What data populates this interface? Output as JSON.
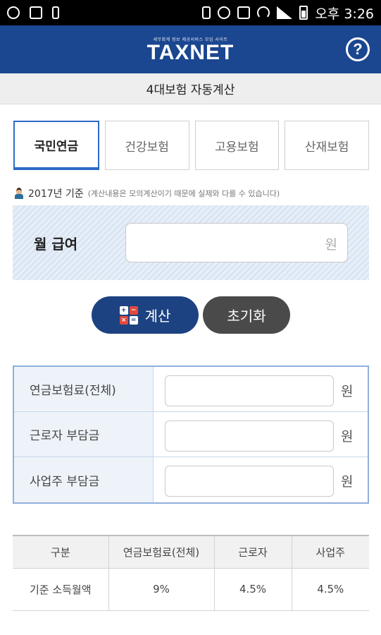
{
  "status_bar": {
    "time": "오후 3:26",
    "icons": [
      "sync-icon",
      "alert-icon",
      "usb-icon",
      "vibrate-icon",
      "alarm-icon",
      "card-icon",
      "wifi-icon",
      "signal-icon",
      "battery-icon"
    ]
  },
  "header": {
    "logo_subtitle": "세무회계 정보 제공서비스 모임 사이트",
    "logo": "TAXNET",
    "help_label": "?"
  },
  "page_title": "4대보험 자동계산",
  "tabs": [
    {
      "label": "국민연금",
      "active": true
    },
    {
      "label": "건강보험",
      "active": false
    },
    {
      "label": "고용보험",
      "active": false
    },
    {
      "label": "산재보험",
      "active": false
    }
  ],
  "note": {
    "year_text": "2017년 기준",
    "detail": "(계산내용은 모의계산이기 때문에 실제와 다를 수 있습니다)"
  },
  "salary": {
    "label": "월 급여",
    "value": "",
    "unit": "원"
  },
  "buttons": {
    "calculate": "계산",
    "reset": "초기화"
  },
  "results": [
    {
      "label": "연금보험료(전체)",
      "value": "",
      "unit": "원"
    },
    {
      "label": "근로자 부담금",
      "value": "",
      "unit": "원"
    },
    {
      "label": "사업주 부담금",
      "value": "",
      "unit": "원"
    }
  ],
  "rate_table": {
    "headers": [
      "구분",
      "연금보험료(전체)",
      "근로자",
      "사업주"
    ],
    "rows": [
      [
        "기준 소득월액",
        "9%",
        "4.5%",
        "4.5%"
      ]
    ]
  },
  "colors": {
    "header_bg": "#1b4690",
    "calc_button": "#1d4282",
    "reset_button": "#4a4a4a",
    "active_tab": "#2d6ac7"
  }
}
